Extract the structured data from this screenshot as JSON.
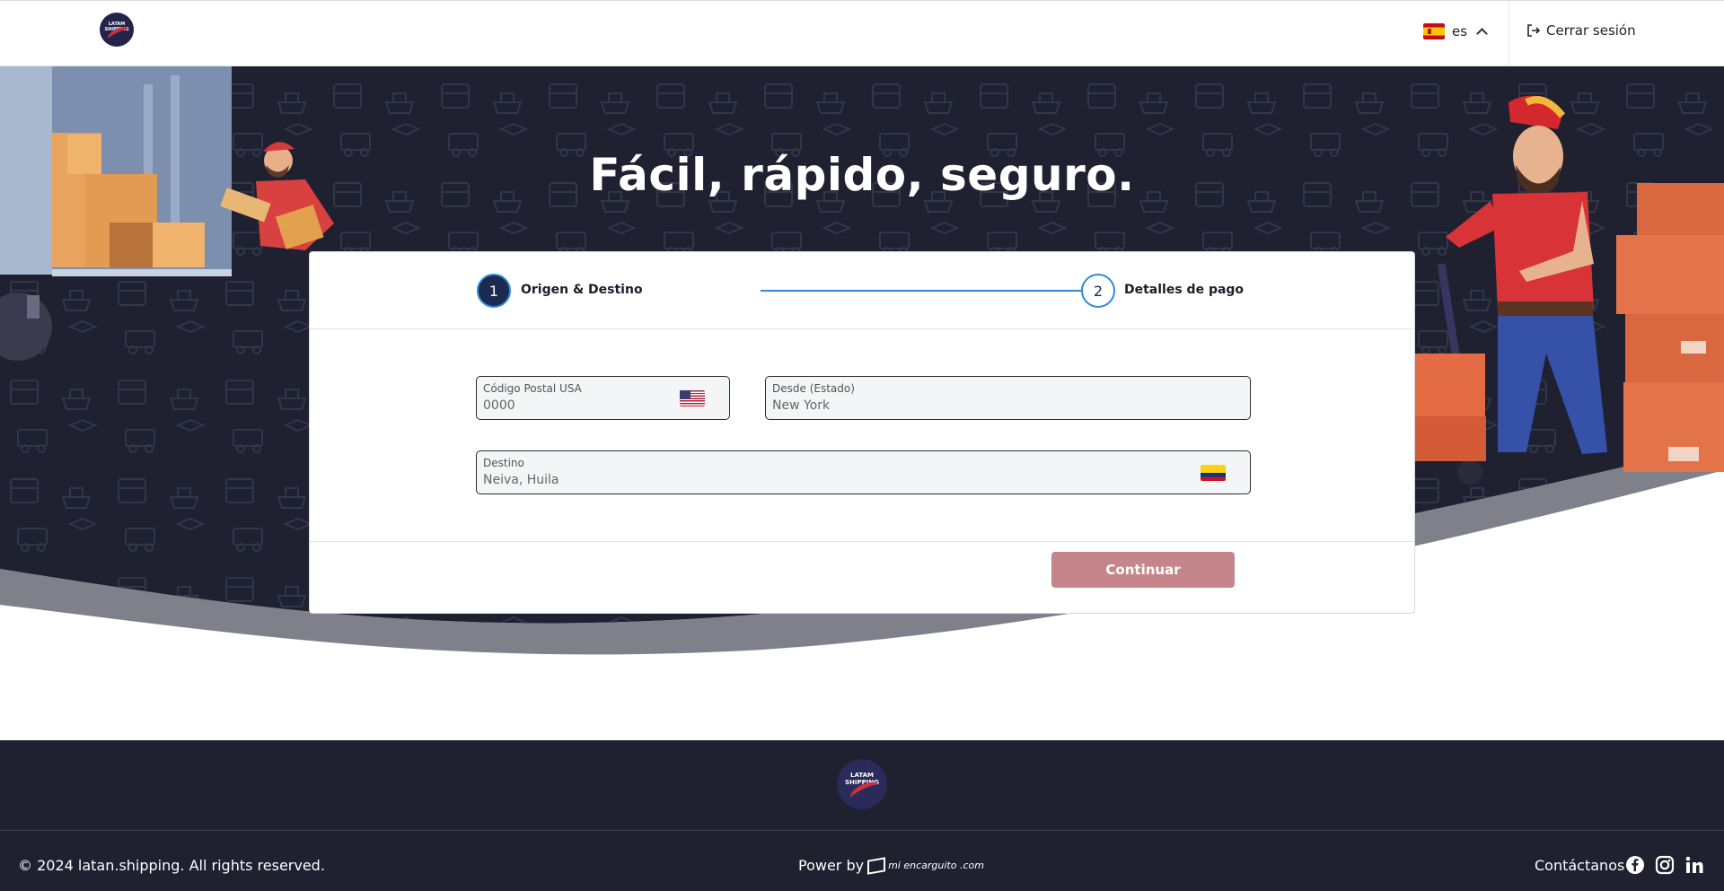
{
  "header": {
    "logo_text": "LATAM SHIPPING",
    "language_code": "es",
    "logout_label": "Cerrar sesión"
  },
  "hero": {
    "headline": "Fácil, rápido, seguro."
  },
  "stepper": {
    "steps": [
      {
        "number": "1",
        "label": "Origen & Destino",
        "state": "active"
      },
      {
        "number": "2",
        "label": "Detalles de pago",
        "state": "pending"
      }
    ]
  },
  "form": {
    "zip": {
      "label": "Código Postal USA",
      "value": "0000",
      "flag": "us-flag-icon"
    },
    "from_state": {
      "label": "Desde (Estado)",
      "value": "New York"
    },
    "destination": {
      "label": "Destino",
      "value": "Neiva, Huila",
      "flag": "co-flag-icon"
    },
    "continue_label": "Continuar"
  },
  "footer": {
    "logo_text": "LATAM SHIPPING",
    "copyright": "© 2024 latan.shipping. All rights reserved.",
    "power_by": "Power by",
    "power_brand": "mi encarguito .com",
    "contact_label": "Contáctanos",
    "social": [
      "facebook-icon",
      "instagram-icon",
      "linkedin-icon"
    ]
  },
  "colors": {
    "hero_bg": "#1f2030",
    "accent_blue": "#2d8ad6",
    "step_active": "#1b2a4e",
    "button_disabled": "#c4868a",
    "footer_bg": "#1f2030"
  }
}
